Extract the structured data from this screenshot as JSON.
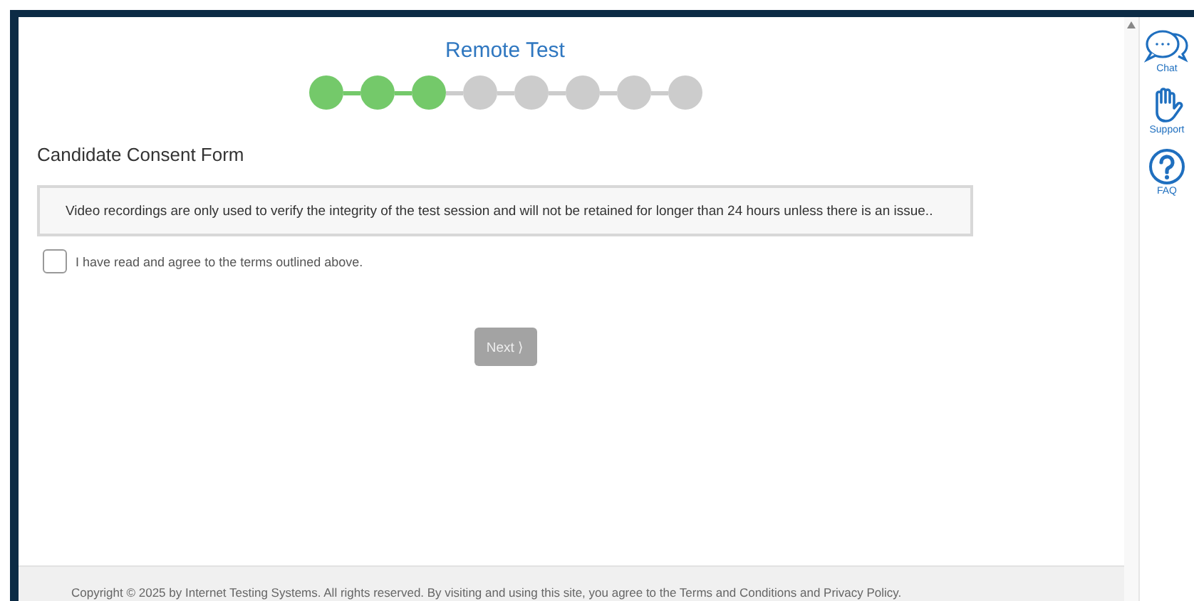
{
  "header": {
    "title": "Remote Test"
  },
  "steps": [
    {
      "done": true
    },
    {
      "done": true
    },
    {
      "done": true
    },
    {
      "done": false
    },
    {
      "done": false
    },
    {
      "done": false
    },
    {
      "done": false
    },
    {
      "done": false
    }
  ],
  "form": {
    "heading": "Candidate Consent Form",
    "notice": "Video recordings are only used to verify the integrity of the test session and will not be retained for longer than 24 hours unless there is an issue..",
    "agree": {
      "label": "I have read and agree to the terms outlined above.",
      "checked": false
    },
    "next_button": {
      "label": "Next ⟩",
      "disabled": true
    }
  },
  "sidebar": [
    {
      "kind": "chat",
      "label": "Chat"
    },
    {
      "kind": "support",
      "label": "Support"
    },
    {
      "kind": "faq",
      "label": "FAQ"
    }
  ],
  "footer": {
    "text": "Copyright © 2025 by Internet Testing Systems. All rights reserved. By visiting and using this site, you agree to the Terms and Conditions and Privacy Policy."
  }
}
